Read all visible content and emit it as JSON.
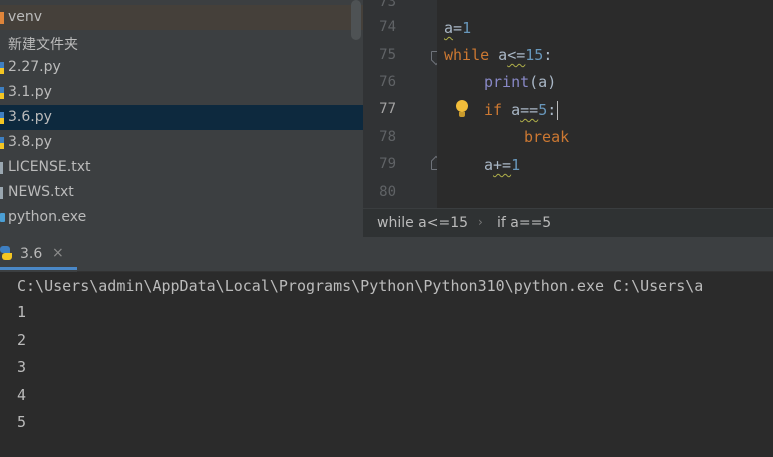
{
  "project_tree": {
    "items": [
      {
        "label": "venv",
        "icon": "folder-icon",
        "selected": false
      },
      {
        "label": "新建文件夹",
        "icon": "none"
      },
      {
        "label": "2.27.py",
        "icon": "python-file-icon"
      },
      {
        "label": "3.1.py",
        "icon": "python-file-icon"
      },
      {
        "label": "3.6.py",
        "icon": "python-file-icon",
        "selected": true
      },
      {
        "label": "3.8.py",
        "icon": "python-file-icon"
      },
      {
        "label": "LICENSE.txt",
        "icon": "text-file-icon"
      },
      {
        "label": "NEWS.txt",
        "icon": "text-file-icon"
      },
      {
        "label": "python.exe",
        "icon": "executable-icon"
      }
    ]
  },
  "editor": {
    "line_numbers": [
      "73",
      "74",
      "75",
      "76",
      "77",
      "78",
      "79",
      "80"
    ],
    "current_line": "77",
    "code": {
      "l74_var": "a",
      "l74_eq": "=",
      "l74_num": "1",
      "l75_kw": "while",
      "l75_var": " a",
      "l75_op": "<=",
      "l75_num": "15",
      "l75_colon": ":",
      "l76_fn": "print",
      "l76_args": "(a)",
      "l77_kw": "if",
      "l77_var": " a",
      "l77_op": "==",
      "l77_num": "5",
      "l77_colon": ":",
      "l78_kw": "break",
      "l79_var": "a",
      "l79_op": "+=",
      "l79_num": "1"
    }
  },
  "breadcrumb": {
    "first": "while a<=15",
    "separator": "›",
    "second": "if a==5"
  },
  "run_panel": {
    "tab_label": "3.6",
    "close_glyph": "×",
    "command_line": "C:\\Users\\admin\\AppData\\Local\\Programs\\Python\\Python310\\python.exe C:\\Users\\a",
    "output_lines": [
      "1",
      "2",
      "3",
      "4",
      "5"
    ]
  },
  "colors": {
    "keyword": "#cc7832",
    "number": "#6897bb",
    "builtin": "#8888c6",
    "text": "#a9b7c6",
    "selection": "#0d293e",
    "tab_underline": "#4a88c7"
  }
}
